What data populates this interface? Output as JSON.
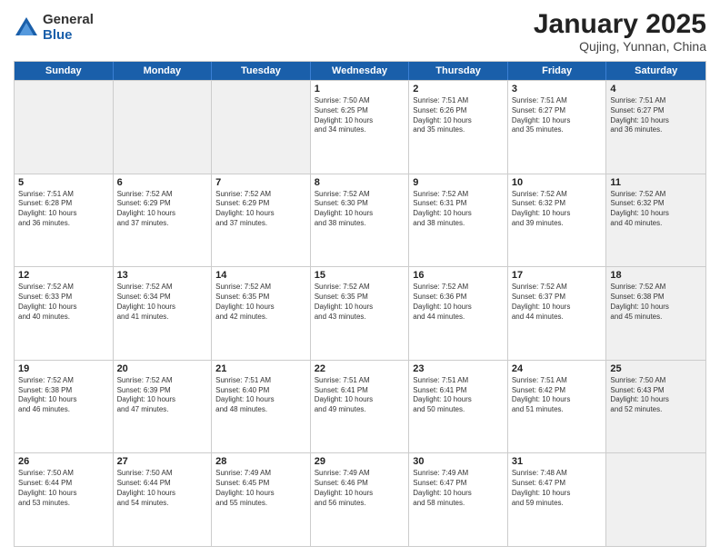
{
  "logo": {
    "general": "General",
    "blue": "Blue"
  },
  "title": "January 2025",
  "location": "Qujing, Yunnan, China",
  "header_days": [
    "Sunday",
    "Monday",
    "Tuesday",
    "Wednesday",
    "Thursday",
    "Friday",
    "Saturday"
  ],
  "rows": [
    [
      {
        "day": "",
        "info": "",
        "shaded": true
      },
      {
        "day": "",
        "info": "",
        "shaded": true
      },
      {
        "day": "",
        "info": "",
        "shaded": true
      },
      {
        "day": "1",
        "info": "Sunrise: 7:50 AM\nSunset: 6:25 PM\nDaylight: 10 hours\nand 34 minutes.",
        "shaded": false
      },
      {
        "day": "2",
        "info": "Sunrise: 7:51 AM\nSunset: 6:26 PM\nDaylight: 10 hours\nand 35 minutes.",
        "shaded": false
      },
      {
        "day": "3",
        "info": "Sunrise: 7:51 AM\nSunset: 6:27 PM\nDaylight: 10 hours\nand 35 minutes.",
        "shaded": false
      },
      {
        "day": "4",
        "info": "Sunrise: 7:51 AM\nSunset: 6:27 PM\nDaylight: 10 hours\nand 36 minutes.",
        "shaded": true
      }
    ],
    [
      {
        "day": "5",
        "info": "Sunrise: 7:51 AM\nSunset: 6:28 PM\nDaylight: 10 hours\nand 36 minutes.",
        "shaded": false
      },
      {
        "day": "6",
        "info": "Sunrise: 7:52 AM\nSunset: 6:29 PM\nDaylight: 10 hours\nand 37 minutes.",
        "shaded": false
      },
      {
        "day": "7",
        "info": "Sunrise: 7:52 AM\nSunset: 6:29 PM\nDaylight: 10 hours\nand 37 minutes.",
        "shaded": false
      },
      {
        "day": "8",
        "info": "Sunrise: 7:52 AM\nSunset: 6:30 PM\nDaylight: 10 hours\nand 38 minutes.",
        "shaded": false
      },
      {
        "day": "9",
        "info": "Sunrise: 7:52 AM\nSunset: 6:31 PM\nDaylight: 10 hours\nand 38 minutes.",
        "shaded": false
      },
      {
        "day": "10",
        "info": "Sunrise: 7:52 AM\nSunset: 6:32 PM\nDaylight: 10 hours\nand 39 minutes.",
        "shaded": false
      },
      {
        "day": "11",
        "info": "Sunrise: 7:52 AM\nSunset: 6:32 PM\nDaylight: 10 hours\nand 40 minutes.",
        "shaded": true
      }
    ],
    [
      {
        "day": "12",
        "info": "Sunrise: 7:52 AM\nSunset: 6:33 PM\nDaylight: 10 hours\nand 40 minutes.",
        "shaded": false
      },
      {
        "day": "13",
        "info": "Sunrise: 7:52 AM\nSunset: 6:34 PM\nDaylight: 10 hours\nand 41 minutes.",
        "shaded": false
      },
      {
        "day": "14",
        "info": "Sunrise: 7:52 AM\nSunset: 6:35 PM\nDaylight: 10 hours\nand 42 minutes.",
        "shaded": false
      },
      {
        "day": "15",
        "info": "Sunrise: 7:52 AM\nSunset: 6:35 PM\nDaylight: 10 hours\nand 43 minutes.",
        "shaded": false
      },
      {
        "day": "16",
        "info": "Sunrise: 7:52 AM\nSunset: 6:36 PM\nDaylight: 10 hours\nand 44 minutes.",
        "shaded": false
      },
      {
        "day": "17",
        "info": "Sunrise: 7:52 AM\nSunset: 6:37 PM\nDaylight: 10 hours\nand 44 minutes.",
        "shaded": false
      },
      {
        "day": "18",
        "info": "Sunrise: 7:52 AM\nSunset: 6:38 PM\nDaylight: 10 hours\nand 45 minutes.",
        "shaded": true
      }
    ],
    [
      {
        "day": "19",
        "info": "Sunrise: 7:52 AM\nSunset: 6:38 PM\nDaylight: 10 hours\nand 46 minutes.",
        "shaded": false
      },
      {
        "day": "20",
        "info": "Sunrise: 7:52 AM\nSunset: 6:39 PM\nDaylight: 10 hours\nand 47 minutes.",
        "shaded": false
      },
      {
        "day": "21",
        "info": "Sunrise: 7:51 AM\nSunset: 6:40 PM\nDaylight: 10 hours\nand 48 minutes.",
        "shaded": false
      },
      {
        "day": "22",
        "info": "Sunrise: 7:51 AM\nSunset: 6:41 PM\nDaylight: 10 hours\nand 49 minutes.",
        "shaded": false
      },
      {
        "day": "23",
        "info": "Sunrise: 7:51 AM\nSunset: 6:41 PM\nDaylight: 10 hours\nand 50 minutes.",
        "shaded": false
      },
      {
        "day": "24",
        "info": "Sunrise: 7:51 AM\nSunset: 6:42 PM\nDaylight: 10 hours\nand 51 minutes.",
        "shaded": false
      },
      {
        "day": "25",
        "info": "Sunrise: 7:50 AM\nSunset: 6:43 PM\nDaylight: 10 hours\nand 52 minutes.",
        "shaded": true
      }
    ],
    [
      {
        "day": "26",
        "info": "Sunrise: 7:50 AM\nSunset: 6:44 PM\nDaylight: 10 hours\nand 53 minutes.",
        "shaded": false
      },
      {
        "day": "27",
        "info": "Sunrise: 7:50 AM\nSunset: 6:44 PM\nDaylight: 10 hours\nand 54 minutes.",
        "shaded": false
      },
      {
        "day": "28",
        "info": "Sunrise: 7:49 AM\nSunset: 6:45 PM\nDaylight: 10 hours\nand 55 minutes.",
        "shaded": false
      },
      {
        "day": "29",
        "info": "Sunrise: 7:49 AM\nSunset: 6:46 PM\nDaylight: 10 hours\nand 56 minutes.",
        "shaded": false
      },
      {
        "day": "30",
        "info": "Sunrise: 7:49 AM\nSunset: 6:47 PM\nDaylight: 10 hours\nand 58 minutes.",
        "shaded": false
      },
      {
        "day": "31",
        "info": "Sunrise: 7:48 AM\nSunset: 6:47 PM\nDaylight: 10 hours\nand 59 minutes.",
        "shaded": false
      },
      {
        "day": "",
        "info": "",
        "shaded": true
      }
    ]
  ]
}
